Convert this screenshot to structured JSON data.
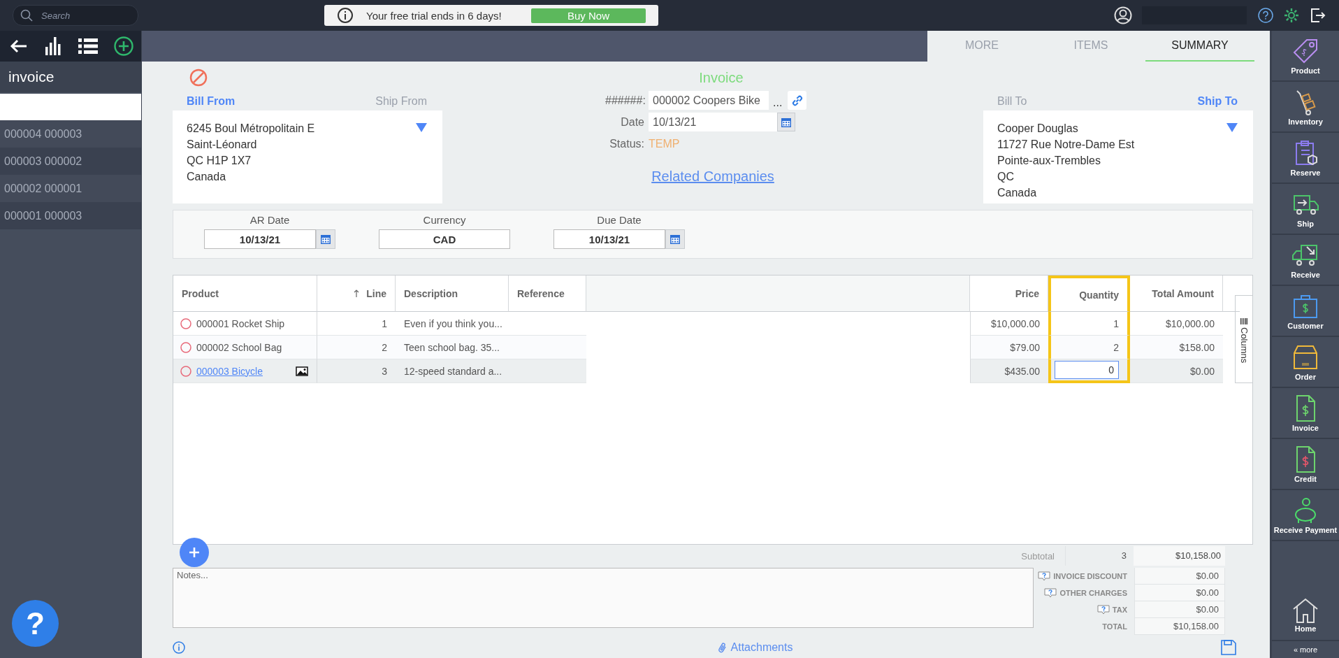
{
  "top_bar": {
    "search_placeholder": "Search",
    "trial_notice": "Your free trial ends in 6 days!",
    "buy_button": "Buy Now"
  },
  "left_panel": {
    "title": "invoice",
    "items": [
      {
        "label": "000004 000003"
      },
      {
        "label": "000003 000002"
      },
      {
        "label": "000002 000001"
      },
      {
        "label": "000001 000003"
      }
    ]
  },
  "tabs": [
    {
      "label": "MORE",
      "selected": false
    },
    {
      "label": "ITEMS",
      "selected": false
    },
    {
      "label": "SUMMARY",
      "selected": true
    }
  ],
  "bill_from": {
    "tabs": [
      {
        "label": "Bill From",
        "selected": true
      },
      {
        "label": "Ship From",
        "selected": false
      }
    ],
    "lines": [
      "6245 Boul Métropolitain E",
      "Saint-Léonard",
      "QC H1P 1X7",
      "Canada"
    ]
  },
  "invoice": {
    "title": "Invoice",
    "number_label": "######:",
    "number": "000002 Coopers Bike",
    "number_more": "...",
    "date_label": "Date",
    "date": "10/13/21",
    "status_label": "Status:",
    "status": "TEMP",
    "related_link": "Related Companies"
  },
  "ship_to": {
    "tabs": [
      {
        "label": "Bill To",
        "selected": false
      },
      {
        "label": "Ship To",
        "selected": true
      }
    ],
    "lines": [
      "Cooper Douglas",
      "11727 Rue Notre-Dame Est",
      "Pointe-aux-Trembles",
      "QC",
      "Canada"
    ]
  },
  "dates": [
    {
      "label": "AR Date",
      "value": "10/13/21",
      "kind": "date"
    },
    {
      "label": "Currency",
      "value": "CAD",
      "kind": "text"
    },
    {
      "label": "Due Date",
      "value": "10/13/21",
      "kind": "date"
    }
  ],
  "table": {
    "columns": [
      {
        "label": "Product",
        "sorted": false,
        "highlighted": false
      },
      {
        "label": "Line",
        "sorted": true,
        "highlighted": false
      },
      {
        "label": "Description",
        "sorted": false,
        "highlighted": false
      },
      {
        "label": "Reference",
        "sorted": false,
        "highlighted": false
      },
      {
        "label": "Price",
        "sorted": false,
        "highlighted": false
      },
      {
        "label": "Quantity",
        "sorted": false,
        "highlighted": true
      },
      {
        "label": "Total Amount",
        "sorted": false,
        "highlighted": false
      }
    ],
    "rows": [
      {
        "product": "000001 Rocket Ship",
        "link": false,
        "has_image": false,
        "line": "1",
        "description": "Even if you think you...",
        "price": "$10,000.00",
        "quantity": "1",
        "total": "$10,000.00",
        "selected": false
      },
      {
        "product": "000002 School Bag",
        "link": false,
        "has_image": false,
        "line": "2",
        "description": "Teen school bag. 35...",
        "price": "$79.00",
        "quantity": "2",
        "total": "$158.00",
        "selected": false
      },
      {
        "product": "000003 Bicycle",
        "link": true,
        "has_image": true,
        "line": "3",
        "description": "12-speed standard a...",
        "price": "$435.00",
        "quantity": "0",
        "total": "$0.00",
        "selected": true
      }
    ],
    "columns_tab": "Columns"
  },
  "subtotal": {
    "label": "Subtotal",
    "quantity": "3",
    "amount": "$10,158.00"
  },
  "notes_placeholder": "Notes...",
  "charges": [
    {
      "label": "INVOICE DISCOUNT",
      "value": "$0.00",
      "help": true
    },
    {
      "label": "OTHER CHARGES",
      "value": "$0.00",
      "help": true
    },
    {
      "label": "TAX",
      "value": "$0.00",
      "help": true
    },
    {
      "label": "TOTAL",
      "value": "$10,158.00",
      "help": false
    }
  ],
  "attachments": "Attachments",
  "help_button": "?",
  "right_nav": {
    "items": [
      {
        "label": "Product"
      },
      {
        "label": "Inventory"
      },
      {
        "label": "Reserve"
      },
      {
        "label": "Ship"
      },
      {
        "label": "Receive"
      },
      {
        "label": "Customer"
      },
      {
        "label": "Order"
      },
      {
        "label": "Invoice"
      },
      {
        "label": "Credit"
      },
      {
        "label": "Receive Payment"
      }
    ],
    "home": "Home",
    "more": "« more"
  }
}
